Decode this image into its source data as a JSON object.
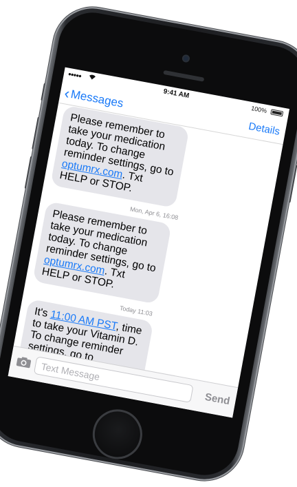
{
  "status_bar": {
    "signal": "●●●●●",
    "time": "9:41 AM",
    "battery": "100%"
  },
  "nav": {
    "back_label": "Messages",
    "details_label": "Details"
  },
  "messages": [
    {
      "pre": "Please remember to take your medication today. To change reminder settings, go to ",
      "link": "optumrx.com",
      "post": ". Txt HELP or STOP."
    },
    {
      "timestamp_day": "Mon, Apr 6,",
      "timestamp_time": " 16:08",
      "pre": "Please remember to take your medication today. To change reminder settings, go to ",
      "link": "optumrx.com",
      "post": ". Txt HELP or STOP."
    },
    {
      "timestamp_day": "Today",
      "timestamp_time": " 11:03",
      "pre": "It's ",
      "link": "11:00 AM PST",
      "post": ", time to take your Vitamin D. To change reminder settings, go to optumrx.com.Txt HELP or STOP."
    }
  ],
  "composer": {
    "placeholder": "Text Message",
    "send_label": "Send"
  },
  "colors": {
    "accent": "#1a7af8",
    "bubble": "#e5e5ea",
    "phone_body": "#1c1d20"
  },
  "icons": {
    "camera": "camera-icon",
    "back": "chevron-left-icon"
  }
}
